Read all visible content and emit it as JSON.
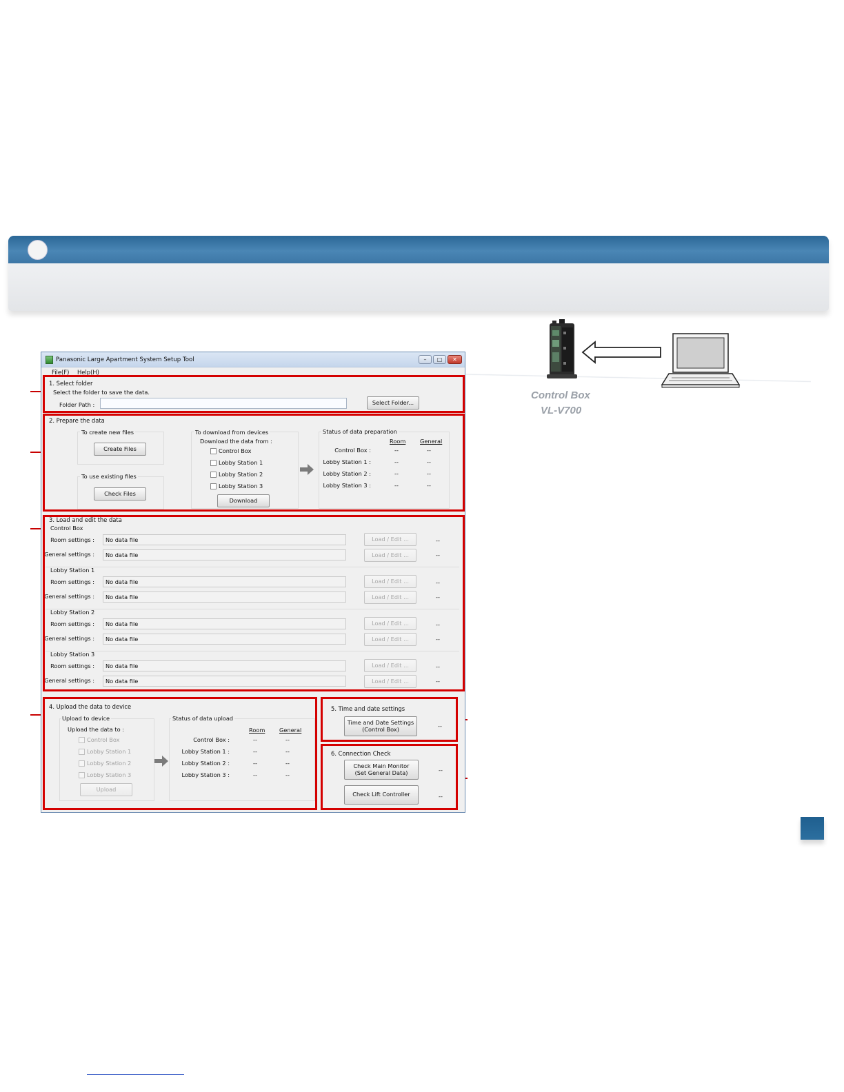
{
  "illustration": {
    "device_label": "Control Box",
    "device_model": "VL-V700"
  },
  "window": {
    "title": "Panasonic Large Apartment System Setup Tool",
    "controls": [
      "–",
      "□",
      "✕"
    ],
    "menu": [
      "File(F)",
      "Help(H)"
    ]
  },
  "section1": {
    "title": "1. Select folder",
    "instruction": "Select the folder to save the data.",
    "folder_path_label": "Folder Path :",
    "folder_path_value": "",
    "select_folder_button": "Select Folder..."
  },
  "section2": {
    "title": "2. Prepare the data",
    "create_group_title": "To create new files",
    "create_button": "Create Files",
    "existing_group_title": "To use existing files",
    "check_button": "Check Files",
    "download_group_title": "To download from devices",
    "download_from_label": "Download the data from :",
    "download_options": [
      "Control Box",
      "Lobby Station 1",
      "Lobby Station 2",
      "Lobby Station 3"
    ],
    "download_button": "Download",
    "status_title": "Status of data preparation",
    "status_headers": [
      "Room",
      "General"
    ],
    "status_rows": [
      {
        "label": "Control Box :",
        "room": "--",
        "general": "--"
      },
      {
        "label": "Lobby Station 1 :",
        "room": "--",
        "general": "--"
      },
      {
        "label": "Lobby Station 2 :",
        "room": "--",
        "general": "--"
      },
      {
        "label": "Lobby Station 3 :",
        "room": "--",
        "general": "--"
      }
    ]
  },
  "section3": {
    "title": "3. Load and edit the data",
    "room_label": "Room settings :",
    "general_label": "General settings :",
    "load_button": "Load / Edit ...",
    "devices": [
      {
        "name": "Control Box",
        "room_file": "No data file",
        "general_file": "No data file",
        "room_status": "--",
        "general_status": "--"
      },
      {
        "name": "Lobby Station 1",
        "room_file": "No data file",
        "general_file": "No data file",
        "room_status": "--",
        "general_status": "--"
      },
      {
        "name": "Lobby Station 2",
        "room_file": "No data file",
        "general_file": "No data file",
        "room_status": "--",
        "general_status": "--"
      },
      {
        "name": "Lobby Station 3",
        "room_file": "No data file",
        "general_file": "No data file",
        "room_status": "--",
        "general_status": "--"
      }
    ]
  },
  "section4": {
    "title": "4. Upload the data to device",
    "upload_group_title": "Upload to device",
    "upload_to_label": "Upload the data to :",
    "upload_options": [
      "Control Box",
      "Lobby Station 1",
      "Lobby Station 2",
      "Lobby Station 3"
    ],
    "upload_button": "Upload",
    "status_title": "Status of data upload",
    "status_headers": [
      "Room",
      "General"
    ],
    "status_rows": [
      {
        "label": "Control Box :",
        "room": "--",
        "general": "--"
      },
      {
        "label": "Lobby Station 1 :",
        "room": "--",
        "general": "--"
      },
      {
        "label": "Lobby Station 2 :",
        "room": "--",
        "general": "--"
      },
      {
        "label": "Lobby Station 3 :",
        "room": "--",
        "general": "--"
      }
    ]
  },
  "section5": {
    "title": "5. Time and date settings",
    "button_line1": "Time and Date Settings",
    "button_line2": "(Control Box)",
    "status": "--"
  },
  "section6": {
    "title": "6. Connection Check",
    "main_monitor_line1": "Check Main Monitor",
    "main_monitor_line2": "(Set General Data)",
    "main_monitor_status": "--",
    "lift_button": "Check Lift Controller",
    "lift_status": "--"
  },
  "colors": {
    "banner_blue": "#3d77a6",
    "highlight_red": "#d40000",
    "corner_blue": "#1f5f8f"
  }
}
